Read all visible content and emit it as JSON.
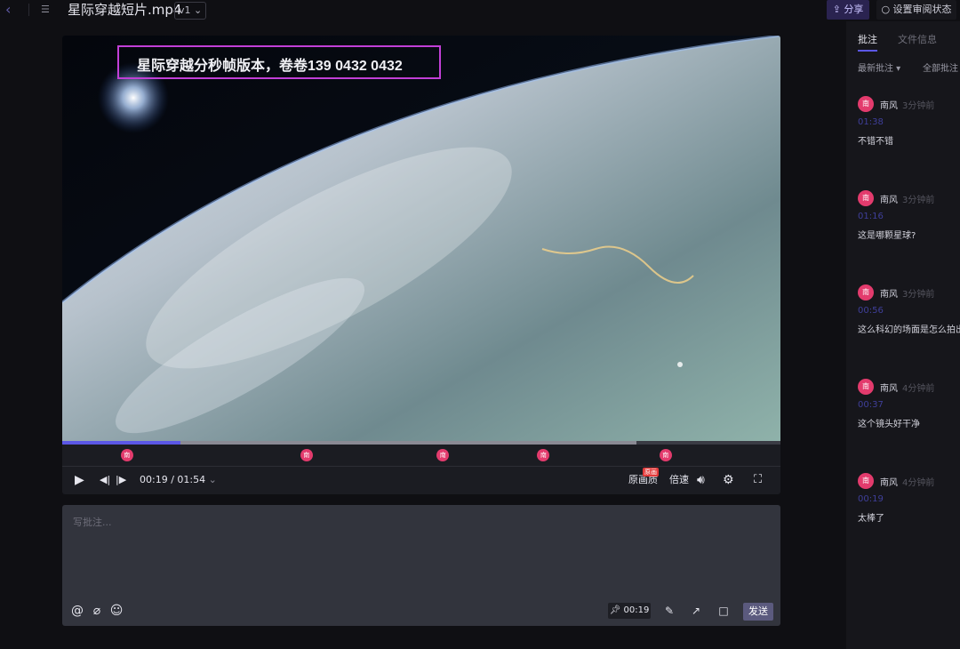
{
  "header": {
    "back_icon": "chevron-left-icon",
    "list_icon": "list-icon",
    "file_title": "星际穿越短片.mp4",
    "version": "v1",
    "share_label": "分享",
    "review_status_label": "设置审阅状态"
  },
  "video": {
    "watermark_text": "星际穿越分秒帧版本，卷卷139 0432 0432",
    "played_fraction": 0.165,
    "buffered_fraction": 0.8,
    "markers": [
      {
        "label": "南",
        "time_fraction": 0.09
      },
      {
        "label": "南",
        "time_fraction": 0.34
      },
      {
        "label": "南",
        "time_fraction": 0.53
      },
      {
        "label": "南",
        "time_fraction": 0.67
      },
      {
        "label": "南",
        "time_fraction": 0.84
      }
    ]
  },
  "controls": {
    "time_display": "00:19 / 01:54",
    "quality_label": "原画质",
    "quality_badge": "原画",
    "speed_label": "倍速"
  },
  "comment_box": {
    "placeholder": "写批注...",
    "timestamp": "00:19",
    "send_label": "发送"
  },
  "sidebar": {
    "tab_comments": "批注",
    "tab_summary": "文件信息",
    "filter_latest": "最新批注",
    "filter_all": "全部批注",
    "comments": [
      {
        "avatar": "南",
        "author": "南风",
        "time": "3分钟前",
        "timestamp": "01:38",
        "text": "不错不错"
      },
      {
        "avatar": "南",
        "author": "南风",
        "time": "3分钟前",
        "timestamp": "01:16",
        "text": "这是哪颗星球?"
      },
      {
        "avatar": "南",
        "author": "南风",
        "time": "3分钟前",
        "timestamp": "00:56",
        "text": "这么科幻的场面是怎么拍出"
      },
      {
        "avatar": "南",
        "author": "南风",
        "time": "4分钟前",
        "timestamp": "00:37",
        "text": "这个镜头好干净"
      },
      {
        "avatar": "南",
        "author": "南风",
        "time": "4分钟前",
        "timestamp": "00:19",
        "text": "太棒了"
      }
    ]
  }
}
